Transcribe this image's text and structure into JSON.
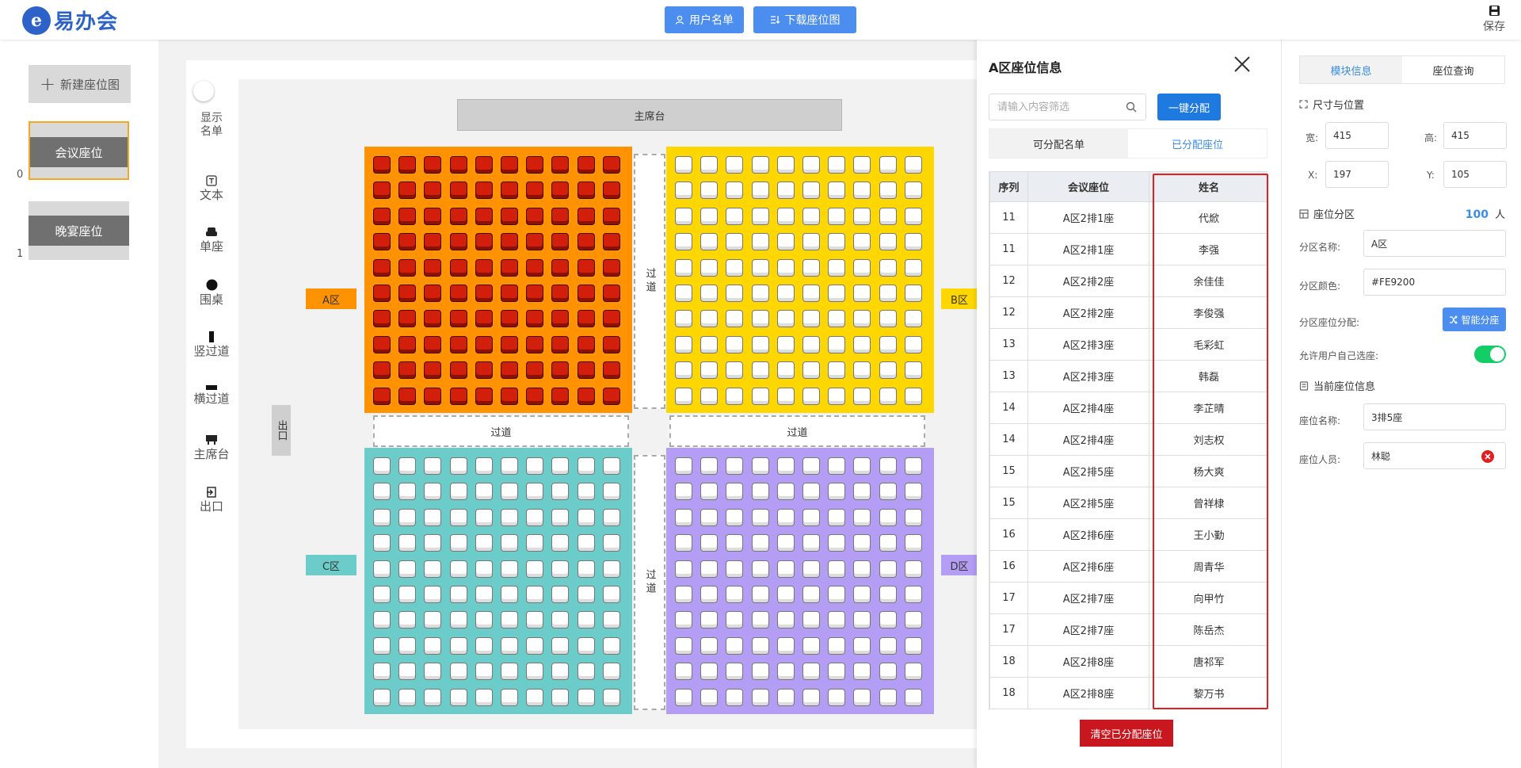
{
  "app": {
    "logo_char": "易",
    "logo_text": "易办会"
  },
  "topbar": {
    "user_list": "用户名单",
    "download": "下载座位图",
    "save": "保存"
  },
  "leftbar": {
    "new_layout": "新建座位图",
    "layouts": [
      {
        "index": "0",
        "name": "会议座位",
        "active": true
      },
      {
        "index": "1",
        "name": "晚宴座位",
        "active": false
      }
    ]
  },
  "tools": {
    "show_list": "显示\n名单",
    "text": "文本",
    "single_seat": "单座",
    "round_table": "围桌",
    "v_aisle": "竖过道",
    "h_aisle": "横过道",
    "dais": "主席台",
    "exit": "出口"
  },
  "stage": {
    "dais_label": "主席台",
    "exit_label": "出口",
    "aisle_label": "过道",
    "zones": [
      {
        "label": "A区",
        "color": "#FE9200",
        "seat_style": "filled"
      },
      {
        "label": "B区",
        "color": "#FFD700",
        "seat_style": "empty"
      },
      {
        "label": "C区",
        "color": "#6CCCCA",
        "seat_style": "empty"
      },
      {
        "label": "D区",
        "color": "#B39DF5",
        "seat_style": "empty"
      }
    ]
  },
  "seat_panel": {
    "title": "A区座位信息",
    "filter_placeholder": "请输入内容筛选",
    "assign_all": "一键分配",
    "tabs": [
      "可分配名单",
      "已分配座位"
    ],
    "active_tab": 1,
    "columns": [
      "序列",
      "会议座位",
      "姓名"
    ],
    "rows": [
      [
        "11",
        "A区2排1座",
        "代焮"
      ],
      [
        "11",
        "A区2排1座",
        "李强"
      ],
      [
        "12",
        "A区2排2座",
        "余佳佳"
      ],
      [
        "12",
        "A区2排2座",
        "李俊强"
      ],
      [
        "13",
        "A区2排3座",
        "毛彩虹"
      ],
      [
        "13",
        "A区2排3座",
        "韩磊"
      ],
      [
        "14",
        "A区2排4座",
        "李芷晴"
      ],
      [
        "14",
        "A区2排4座",
        "刘志权"
      ],
      [
        "15",
        "A区2排5座",
        "杨大爽"
      ],
      [
        "15",
        "A区2排5座",
        "曾祥棣"
      ],
      [
        "16",
        "A区2排6座",
        "王小勤"
      ],
      [
        "16",
        "A区2排6座",
        "周青华"
      ],
      [
        "17",
        "A区2排7座",
        "向甲竹"
      ],
      [
        "17",
        "A区2排7座",
        "陈岳杰"
      ],
      [
        "18",
        "A区2排8座",
        "唐祁军"
      ],
      [
        "18",
        "A区2排8座",
        "黎万书"
      ]
    ],
    "clear": "清空已分配座位"
  },
  "props": {
    "tabs": [
      "模块信息",
      "座位查询"
    ],
    "active_tab": 0,
    "size_pos": {
      "title": "尺寸与位置",
      "w_label": "宽:",
      "w": "415",
      "h_label": "高:",
      "h": "415",
      "x_label": "X:",
      "x": "197",
      "y_label": "Y:",
      "y": "105"
    },
    "zone": {
      "title": "座位分区",
      "count": "100",
      "unit": "人",
      "name_label": "分区名称:",
      "name": "A区",
      "color_label": "分区颜色:",
      "color": "#FE9200",
      "alloc_label": "分区座位分配:",
      "smart": "智能分座",
      "self_select_label": "允许用户自己选座:",
      "self_select": true
    },
    "current": {
      "title": "当前座位信息",
      "seat_label": "座位名称:",
      "seat": "3排5座",
      "person_label": "座位人员:",
      "person": "林聪"
    }
  }
}
